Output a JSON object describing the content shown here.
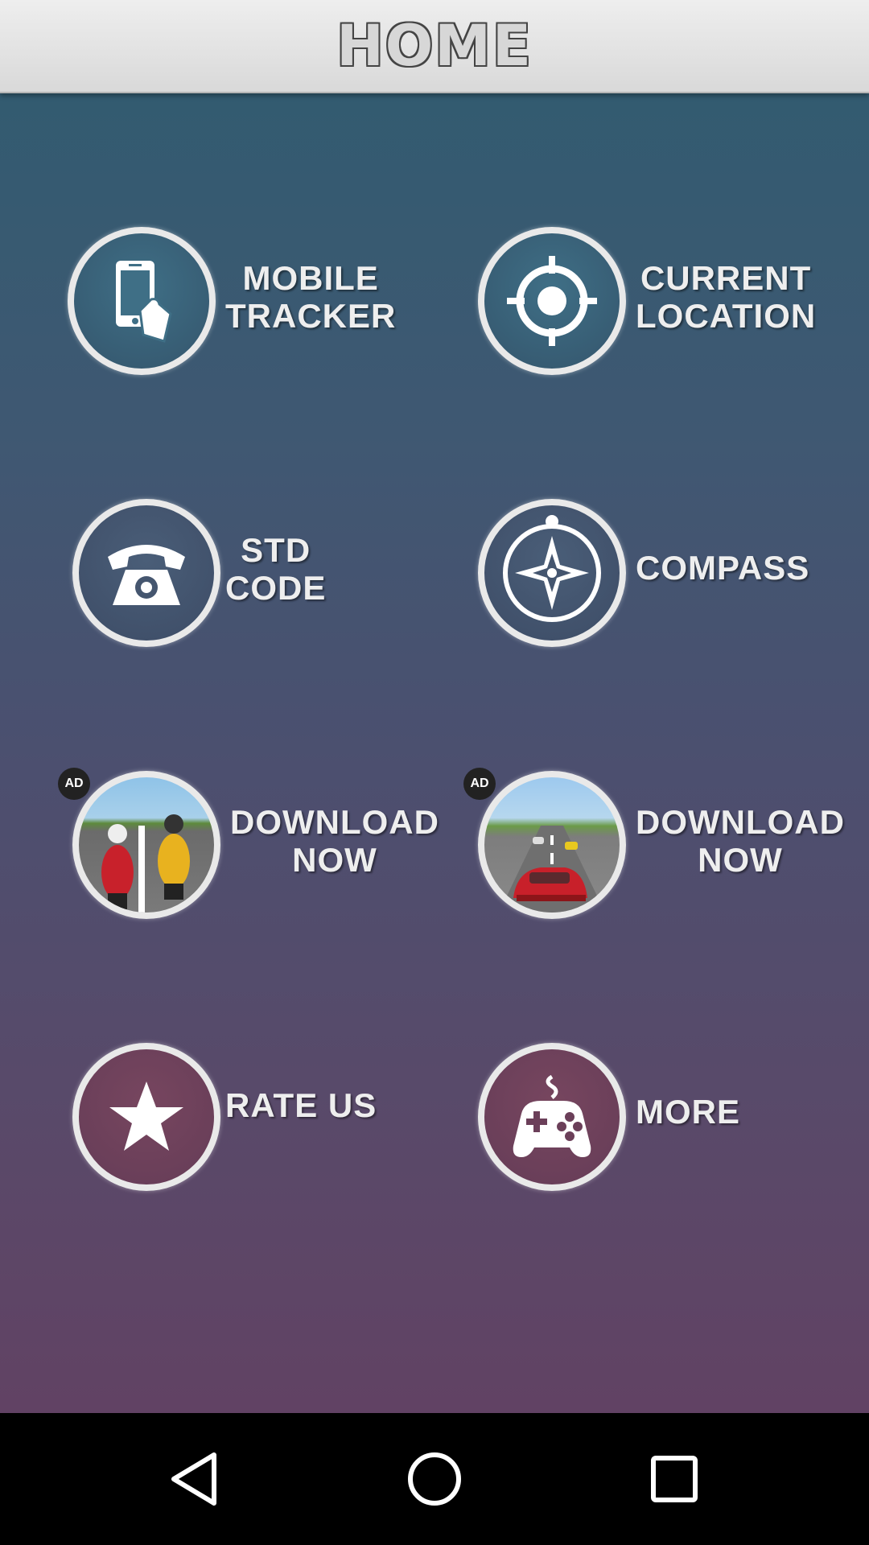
{
  "header": {
    "title": "HOME"
  },
  "tiles": [
    {
      "lines": [
        "MOBILE",
        "TRACKER"
      ],
      "icon": "phone-hand-icon"
    },
    {
      "lines": [
        "CURRENT",
        "LOCATION"
      ],
      "icon": "location-target-icon"
    },
    {
      "lines": [
        "STD",
        "CODE"
      ],
      "icon": "telephone-icon"
    },
    {
      "lines": [
        "COMPASS"
      ],
      "icon": "compass-icon"
    },
    {
      "lines": [
        "DOWNLOAD",
        "NOW"
      ],
      "badge": "AD",
      "icon": "bike-race-thumbnail"
    },
    {
      "lines": [
        "DOWNLOAD",
        "NOW"
      ],
      "badge": "AD",
      "icon": "car-race-thumbnail"
    },
    {
      "lines": [
        "RATE US"
      ],
      "icon": "star-icon"
    },
    {
      "lines": [
        "MORE"
      ],
      "icon": "gamepad-icon"
    }
  ],
  "navbar": {
    "buttons": [
      "back-icon",
      "home-icon",
      "recents-icon"
    ]
  },
  "colors": {
    "header_bg": "#e3e3e3",
    "circle_border": "#e9e9e9",
    "label_text": "#eeeeee",
    "navbar_bg": "#000000"
  }
}
